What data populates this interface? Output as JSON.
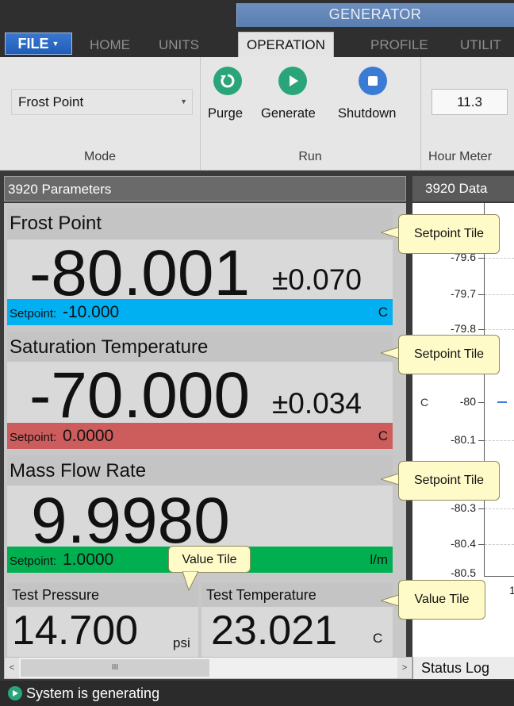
{
  "ribbon": {
    "group_title": "GENERATOR",
    "file_label": "FILE",
    "tabs": [
      "HOME",
      "UNITS",
      "OPERATION",
      "PROFILE",
      "UTILIT"
    ],
    "mode": {
      "value": "Frost Point",
      "label": "Mode"
    },
    "run": {
      "purge": "Purge",
      "generate": "Generate",
      "shutdown": "Shutdown",
      "label": "Run"
    },
    "hour_meter": {
      "value": "11.3",
      "label": "Hour Meter"
    }
  },
  "panels": {
    "params_title": "3920 Parameters",
    "data_title": "3920 Data"
  },
  "tiles": [
    {
      "title": "Frost Point",
      "value": "-80.001",
      "tolerance": "±0.070",
      "setpoint_label": "Setpoint:",
      "setpoint_value": "-10.000",
      "unit": "C",
      "color": "#00b0f0"
    },
    {
      "title": "Saturation Temperature",
      "value": "-70.000",
      "tolerance": "±0.034",
      "setpoint_label": "Setpoint:",
      "setpoint_value": "0.0000",
      "unit": "C",
      "color": "#cd5c5c"
    },
    {
      "title": "Mass Flow Rate",
      "value": "9.9980",
      "setpoint_label": "Setpoint:",
      "setpoint_value": "1.0000",
      "unit": "l/m",
      "color": "#00b050"
    }
  ],
  "small_tiles": [
    {
      "title": "Test Pressure",
      "value": "14.700",
      "unit": "psi"
    },
    {
      "title": "Test Temperature",
      "value": "23.021",
      "unit": "C"
    }
  ],
  "callouts": {
    "setpoint": "Setpoint Tile",
    "value": "Value Tile"
  },
  "chart": {
    "ticks": [
      "-79.6",
      "-79.7",
      "-79.8",
      "-80",
      "-80.1",
      "-80.3",
      "-80.4",
      "-80.5"
    ],
    "axis_symbol": "C",
    "x_tick": "1"
  },
  "bottom": {
    "scroll_grip": "III",
    "status_log": "Status Log",
    "status_text": "System is generating"
  }
}
